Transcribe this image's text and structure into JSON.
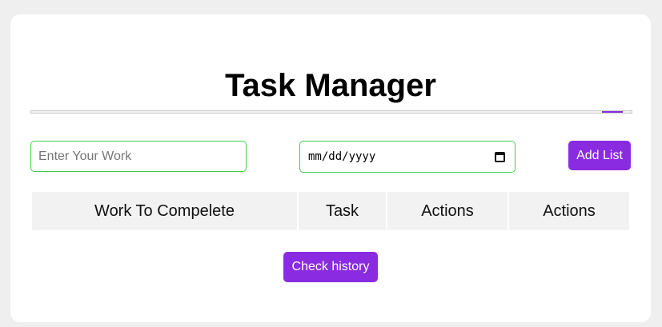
{
  "app": {
    "title": "Task Manager"
  },
  "progress": {
    "fill_start_fraction": 0.95,
    "fill_end_fraction": 0.985,
    "accent_color": "#8a2be2"
  },
  "form": {
    "work_placeholder": "Enter Your Work",
    "work_value": "",
    "date_placeholder": "mm/dd/yyyy",
    "add_button_label": "Add List",
    "input_border_color": "#3fd14a"
  },
  "table": {
    "headers": [
      "Work To Compelete",
      "Task",
      "Actions",
      "Actions"
    ]
  },
  "footer": {
    "history_button_label": "Check history"
  },
  "icons": {
    "date_picker": "calendar-icon"
  }
}
